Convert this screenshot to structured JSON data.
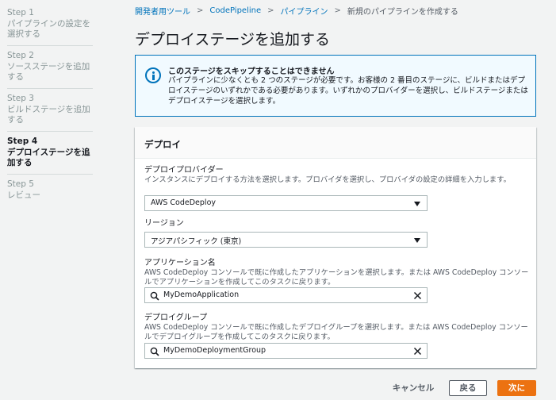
{
  "sidebar": {
    "steps": [
      {
        "number": "Step 1",
        "label": "パイプラインの設定を選択する",
        "current": false
      },
      {
        "number": "Step 2",
        "label": "ソースステージを追加する",
        "current": false
      },
      {
        "number": "Step 3",
        "label": "ビルドステージを追加する",
        "current": false
      },
      {
        "number": "Step 4",
        "label": "デプロイステージを追加する",
        "current": true
      },
      {
        "number": "Step 5",
        "label": "レビュー",
        "current": false
      }
    ]
  },
  "breadcrumb": {
    "items": [
      "開発者用ツール",
      "CodePipeline",
      "パイプライン"
    ],
    "separator": ">",
    "current": "新規のパイプラインを作成する"
  },
  "page": {
    "title": "デプロイステージを追加する"
  },
  "alert": {
    "icon": "info-icon",
    "title": "このステージをスキップすることはできません",
    "body": "パイプラインに少なくとも 2 つのステージが必要です。お客様の 2 番目のステージに、ビルドまたはデプロイステージのいずれかである必要があります。いずれかのプロバイダーを選択し、ビルドステージまたはデプロイステージを選択します。"
  },
  "deploy": {
    "title": "デプロイ",
    "provider": {
      "label": "デプロイプロバイダー",
      "description": "インスタンスにデプロイする方法を選択します。プロバイダを選択し、プロバイダの設定の詳細を入力します。",
      "value": "AWS CodeDeploy"
    },
    "region": {
      "label": "リージョン",
      "value": "アジアパシフィック (東京)"
    },
    "application": {
      "label": "アプリケーション名",
      "description": "AWS CodeDeploy コンソールで既に作成したアプリケーションを選択します。または AWS CodeDeploy コンソールでアプリケーションを作成してこのタスクに戻ります。",
      "value": "MyDemoApplication"
    },
    "group": {
      "label": "デプロイグループ",
      "description": "AWS CodeDeploy コンソールで既に作成したデプロイグループを選択します。または AWS CodeDeploy コンソールでデプロイグループを作成してこのタスクに戻ります。",
      "value": "MyDemoDeploymentGroup"
    }
  },
  "footer": {
    "cancel": "キャンセル",
    "back": "戻る",
    "next": "次に"
  },
  "colors": {
    "accent": "#0073bb",
    "primary_button": "#ec7211"
  }
}
